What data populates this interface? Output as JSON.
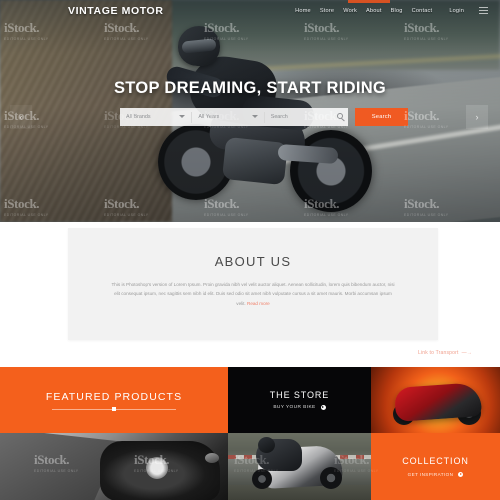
{
  "site": {
    "brand": "VINTAGE MOTOR",
    "nav": [
      {
        "label": "Home"
      },
      {
        "label": "Store"
      },
      {
        "label": "Work"
      },
      {
        "label": "About"
      },
      {
        "label": "Blog"
      },
      {
        "label": "Contact"
      }
    ],
    "login_label": "Login",
    "accent_color": "#f4601c",
    "dark_color": "#060608"
  },
  "hero": {
    "headline": "STOP DREAMING, START RIDING",
    "search": {
      "brands_value": "All Brands",
      "years_value": "All Years",
      "query_placeholder": "Search",
      "button_label": "Search"
    },
    "prev_arrow": "‹",
    "next_arrow": "›"
  },
  "about": {
    "title": "ABOUT US",
    "body": "This is Photoshop's version  of Lorem Ipsum. Proin gravida nibh vel velit auctor aliquet. Aenean sollicitudin, lorem quis bibendum auctor, nisi elit consequat ipsum, nec sagittis sem nibh id elit. Duis sed odio sit amet nibh vulputate cursus a sit amet mauris. Morbi accumsan ipsum velit.",
    "read_more": "Read more",
    "link_label": "Link to Transport",
    "link_arrow": "—→"
  },
  "panels": {
    "featured": {
      "title": "FEATURED PRODUCTS"
    },
    "store": {
      "title": "THE STORE",
      "subtitle": "BUY YOUR BIKE"
    },
    "collection": {
      "title": "COLLECTION",
      "subtitle": "GET INSPIRATION"
    }
  },
  "watermark": {
    "text": "iStock.",
    "subtext": "EDITORIAL USE ONLY"
  }
}
